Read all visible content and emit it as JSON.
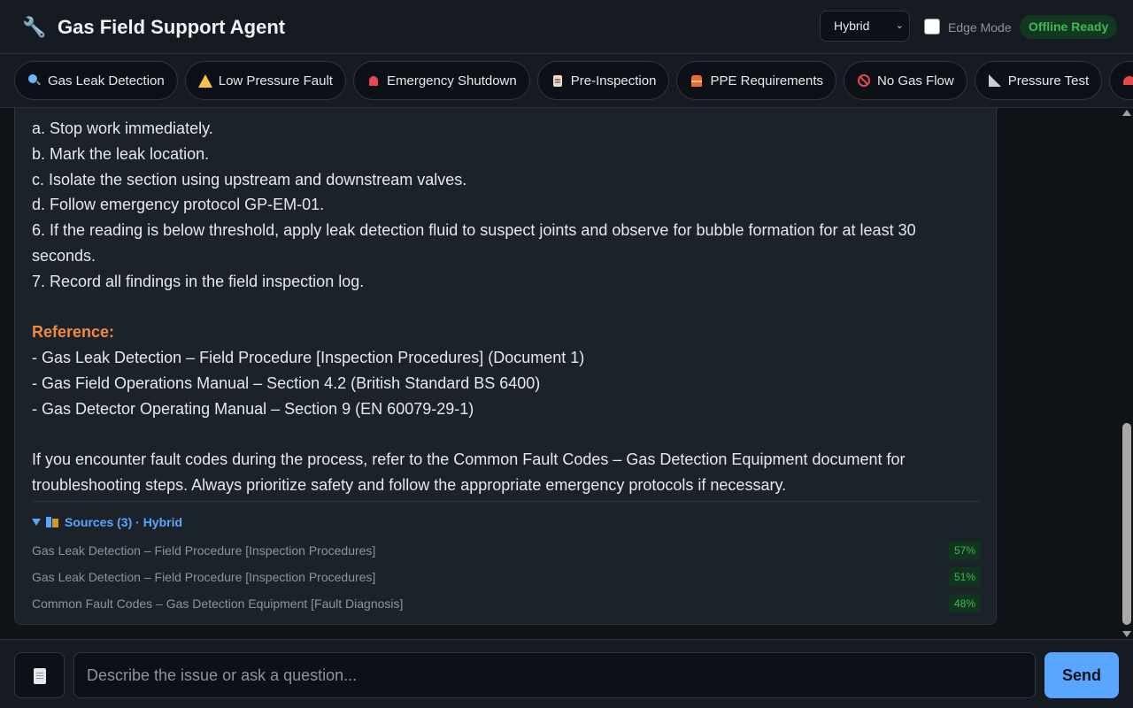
{
  "header": {
    "icon": "wrench-icon",
    "title": "Gas Field Support Agent",
    "mode_select": {
      "value": "Hybrid"
    },
    "edge_mode": {
      "label": "Edge Mode",
      "checked": false
    },
    "status_badge": "Offline Ready"
  },
  "quick_actions": [
    {
      "icon": "magnifier-icon",
      "label": "Gas Leak Detection"
    },
    {
      "icon": "warning-icon",
      "label": "Low Pressure Fault"
    },
    {
      "icon": "siren-icon",
      "label": "Emergency Shutdown"
    },
    {
      "icon": "clipboard-icon",
      "label": "Pre-Inspection"
    },
    {
      "icon": "safety-vest-icon",
      "label": "PPE Requirements"
    },
    {
      "icon": "prohibited-icon",
      "label": "No Gas Flow"
    },
    {
      "icon": "triangle-ruler-icon",
      "label": "Pressure Test"
    },
    {
      "icon": "helmet-icon",
      "label": ""
    }
  ],
  "message": {
    "lines": [
      "a. Stop work immediately.",
      "b. Mark the leak location.",
      "c. Isolate the section using upstream and downstream valves.",
      "d. Follow emergency protocol GP-EM-01.",
      "6. If the reading is below threshold, apply leak detection fluid to suspect joints and observe for bubble formation for at least 30 seconds.",
      "7. Record all findings in the field inspection log."
    ],
    "reference_heading": "Reference:",
    "references": [
      "- Gas Leak Detection – Field Procedure [Inspection Procedures] (Document 1)",
      "- Gas Field Operations Manual – Section 4.2 (British Standard BS 6400)",
      "- Gas Detector Operating Manual – Section 9 (EN 60079-29-1)"
    ],
    "closing": "If you encounter fault codes during the process, refer to the Common Fault Codes – Gas Detection Equipment document for troubleshooting steps. Always prioritize safety and follow the appropriate emergency protocols if necessary."
  },
  "sources": {
    "toggle_label": "Sources (3) · Hybrid",
    "items": [
      {
        "title": "Gas Leak Detection – Field Procedure [Inspection Procedures]",
        "score": "57%"
      },
      {
        "title": "Gas Leak Detection – Field Procedure [Inspection Procedures]",
        "score": "51%"
      },
      {
        "title": "Common Fault Codes – Gas Detection Equipment [Fault Diagnosis]",
        "score": "48%"
      }
    ]
  },
  "composer": {
    "attach_icon": "document-icon",
    "placeholder": "Describe the issue or ask a question...",
    "value": "",
    "send_label": "Send"
  },
  "colors": {
    "background": "#0f1419",
    "panel": "#161b22",
    "card": "#1c222a",
    "accent": "#58a6ff",
    "reference": "#f0883e",
    "success": "#3fb950"
  }
}
